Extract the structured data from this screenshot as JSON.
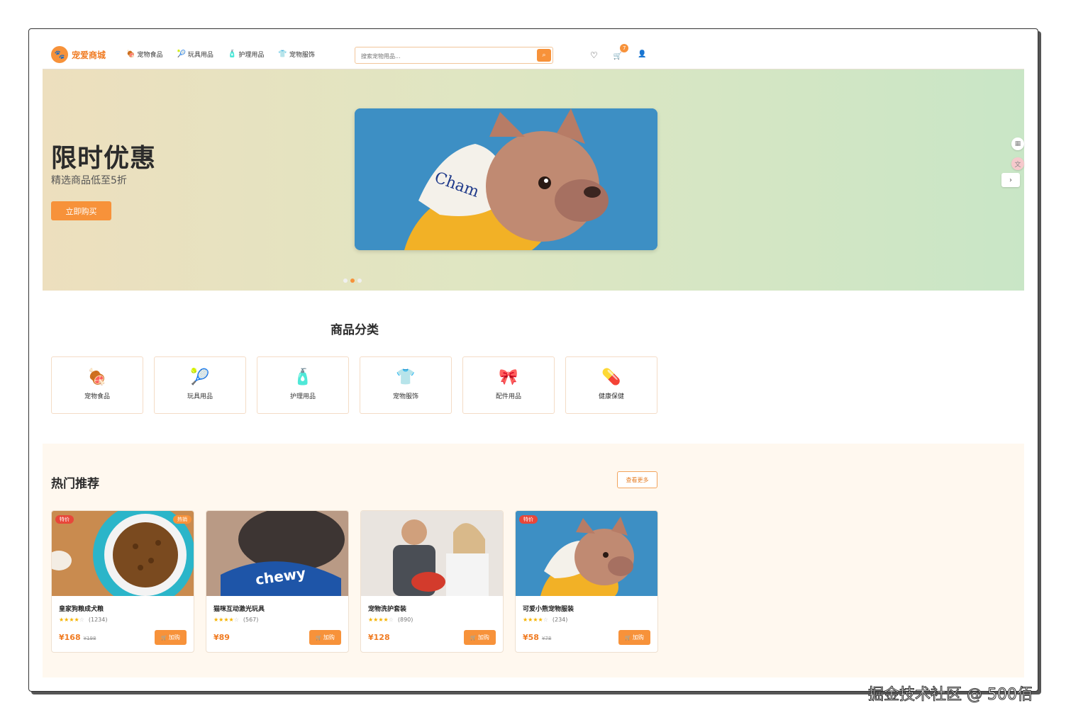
{
  "header": {
    "logo_icon": "🐾",
    "logo_text": "宠爱商城",
    "nav": [
      {
        "icon": "🍖",
        "label": "宠物食品"
      },
      {
        "icon": "🎾",
        "label": "玩具用品"
      },
      {
        "icon": "🧴",
        "label": "护理用品"
      },
      {
        "icon": "👕",
        "label": "宠物服饰"
      }
    ],
    "search_placeholder": "搜索宠物用品...",
    "search_icon": "⌕",
    "fav_icon": "♡",
    "cart_icon": "🛒",
    "cart_count": "7",
    "user_icon": "👤"
  },
  "hero": {
    "title": "限时优惠",
    "subtitle": "精选商品低至5折",
    "button": "立即购买",
    "next_icon": "›",
    "dots": 3,
    "active_dot": 1
  },
  "categories": {
    "title": "商品分类",
    "items": [
      {
        "icon": "🍖",
        "label": "宠物食品"
      },
      {
        "icon": "🎾",
        "label": "玩具用品"
      },
      {
        "icon": "🧴",
        "label": "护理用品"
      },
      {
        "icon": "👕",
        "label": "宠物服饰"
      },
      {
        "icon": "🎀",
        "label": "配件用品"
      },
      {
        "icon": "💊",
        "label": "健康保健"
      }
    ]
  },
  "hot": {
    "title": "热门推荐",
    "more_button": "查看更多",
    "products": [
      {
        "name": "皇家狗粮成犬粮",
        "rating": 4,
        "reviews": "(1234)",
        "price": "¥168",
        "old_price": "¥198",
        "tag_left": "特价",
        "tag_right": "热销",
        "add_label": "加购"
      },
      {
        "name": "猫咪互动激光玩具",
        "rating": 4,
        "reviews": "(567)",
        "price": "¥89",
        "old_price": "",
        "tag_left": "",
        "tag_right": "",
        "add_label": "加购"
      },
      {
        "name": "宠物洗护套装",
        "rating": 4,
        "reviews": "(890)",
        "price": "¥128",
        "old_price": "",
        "tag_left": "",
        "tag_right": "",
        "add_label": "加购"
      },
      {
        "name": "可爱小熊宠物服装",
        "rating": 4,
        "reviews": "(234)",
        "price": "¥58",
        "old_price": "¥78",
        "tag_left": "特价",
        "tag_right": "",
        "add_label": "加购"
      }
    ]
  },
  "watermark": "掘金技术社区 @ 500佰"
}
